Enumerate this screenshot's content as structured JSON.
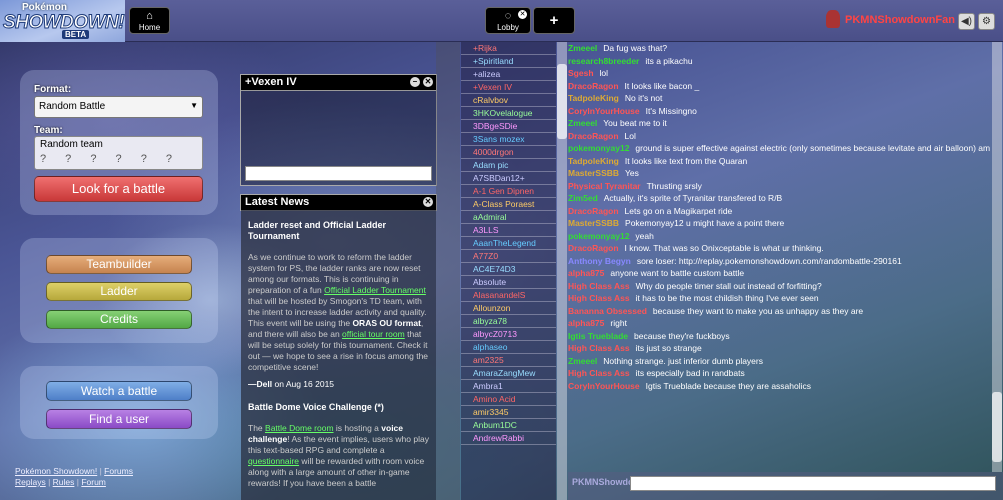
{
  "app": {
    "logo_top": "Pokémon",
    "logo_main": "SHOWDOWN!",
    "logo_badge": "BETA"
  },
  "header": {
    "home_label": "Home",
    "lobby_label": "Lobby",
    "add_label": "+",
    "username": "PKMNShowdownFan"
  },
  "battle": {
    "format_label": "Format:",
    "format_value": "Random Battle",
    "team_label": "Team:",
    "team_value": "Random team",
    "look_label": "Look for a battle"
  },
  "menu": {
    "teambuilder": "Teambuilder",
    "ladder": "Ladder",
    "credits": "Credits",
    "watch": "Watch a battle",
    "find": "Find a user"
  },
  "footer": {
    "links_row1": [
      "Pokémon Showdown!",
      "Forums"
    ],
    "links_row2": [
      "Replays",
      "Rules",
      "Forum"
    ]
  },
  "pm": {
    "title": "+Vexen IV"
  },
  "news": {
    "title": "Latest News",
    "h1": "Ladder reset and Official Ladder Tournament",
    "p1a": "As we continue to work to reform the ladder system for PS, the ladder ranks are now reset among our formats. This is continuing in preparation of a fun",
    "link1": "Official Ladder Tournament",
    "p1b": "that will be hosted by Smogon's TD team, with the intent to increase ladder activity and quality. This event will be using the",
    "bold1": "ORAS OU format",
    "p1c": ", and there will also be an",
    "link2": "official tour room",
    "p1d": "that will be setup solely for this tournament. Check it out — we hope to see a rise in focus among the competitive scene!",
    "author": "—Dell",
    "date": "on Aug 16 2015",
    "h2": "Battle Dome Voice Challenge (*)",
    "p2a": "The",
    "link3": "Battle Dome room",
    "p2b": "is hosting a",
    "bold2": "voice challenge",
    "p2c": "! As the event implies, users who play this text-based RPG and complete a",
    "link4": "questionnaire",
    "p2d": "will be rewarded with room voice along with a large amount of other in-game rewards! If you have been a battle"
  },
  "userlist": [
    "+Rijka",
    "+Spiritland",
    "+alizea",
    "+Vexen IV",
    "cRalvbov",
    "3HKOvelalogue",
    "3DBgeSDie",
    "3Sans mozex",
    "4000drgon",
    "Adam pic",
    "A7SBDan12+",
    "A-1 Gen Dipnen",
    "A-Class Poraest",
    "aAdmiral",
    "A3LLS",
    "AaanTheLegend",
    "A77Z0",
    "AC4E74D3",
    "Absolute",
    "AlasanandelS",
    "Allounzon",
    "albyza78",
    "albycZ0713",
    "alphaseo",
    "am2325",
    "AmaraZangMew",
    "Ambra1",
    " Amino Acid",
    "amir3345",
    "Anbum1DC",
    "AndrewRabbi"
  ],
  "chat": [
    {
      "n": "Zmeeel",
      "t": "Da fug was that?",
      "c": "#3d3"
    },
    {
      "n": "research8breeder",
      "t": "its a pikachu",
      "c": "#3d3"
    },
    {
      "n": "Sgesh",
      "t": "lol",
      "c": "#f55"
    },
    {
      "n": "DracoRagon",
      "t": "It looks like bacon _",
      "c": "#f55"
    },
    {
      "n": "TadpoleKing",
      "t": "No it's not",
      "c": "#da3"
    },
    {
      "n": "CorylnYourHouse",
      "t": "It's Missingno",
      "c": "#f55"
    },
    {
      "n": "Zmeeel",
      "t": "You beat me to it",
      "c": "#3d3"
    },
    {
      "n": "DracoRagon",
      "t": "Lol",
      "c": "#f55"
    },
    {
      "n": "pokemonyay12",
      "t": "ground is super effective against electric (only sometimes because levitate and air balloon) am I right",
      "c": "#3d3"
    },
    {
      "n": "TadpoleKing",
      "t": "It looks like text from the Quaran",
      "c": "#da3"
    },
    {
      "n": "MasterSSBB",
      "t": "Yes",
      "c": "#da3"
    },
    {
      "n": "Physical Tyranitar",
      "t": "Thrusting srsly",
      "c": "#f55"
    },
    {
      "n": "Zim5ed",
      "t": "Actually, it's sprite of Tyranitar transfered to R/B",
      "c": "#3d3"
    },
    {
      "n": "DracoRagon",
      "t": "Lets go on a Magikarpet ride",
      "c": "#f55"
    },
    {
      "n": "MasterSSBB",
      "t": "Pokemonyay12 u might have a point there",
      "c": "#da3"
    },
    {
      "n": "pokemonyay12",
      "t": "yeah",
      "c": "#3d3"
    },
    {
      "n": "DracoRagon",
      "t": "I know. That was so Onixceptable is what ur thinking.",
      "c": "#f55"
    },
    {
      "n": "Anthony Begyn",
      "t": "sore loser: http://replay.pokemonshowdown.com/randombattle-290161",
      "c": "#88f"
    },
    {
      "n": "alpha875",
      "t": "anyone want to battle custom battle",
      "c": "#f55"
    },
    {
      "n": "High Class Ass",
      "t": "Why do people timer stall out instead of forfitting?",
      "c": "#f55"
    },
    {
      "n": "High Class Ass",
      "t": "it has to be the most childish thing I've ever seen",
      "c": "#f55"
    },
    {
      "n": "Bananna Obsessed",
      "t": "because they want to make you as unhappy as they are",
      "c": "#f55"
    },
    {
      "n": "alpha875",
      "t": "right",
      "c": "#f55"
    },
    {
      "n": "Igtis Trueblade",
      "t": "because they're fuckboys",
      "c": "#3d3"
    },
    {
      "n": "High Class Ass",
      "t": "its just so strange",
      "c": "#f55"
    },
    {
      "n": "Zmeeel",
      "t": "Nothing strange. just inferior dumb players",
      "c": "#3d3"
    },
    {
      "n": "High Class Ass",
      "t": "its especially bad in randbats",
      "c": "#f55"
    },
    {
      "n": "CorylnYourHouse",
      "t": "Igtis Trueblade because they are assaholics",
      "c": "#f55"
    }
  ],
  "chatbar": {
    "name": "PKMNShowdownFan:"
  },
  "colors": {
    "look": "#e05050",
    "teambuilder": "#d5935f",
    "ladder": "#c7b84d",
    "credits": "#66bb55",
    "watch": "#5d8fd6",
    "find": "#9a5ad2"
  }
}
